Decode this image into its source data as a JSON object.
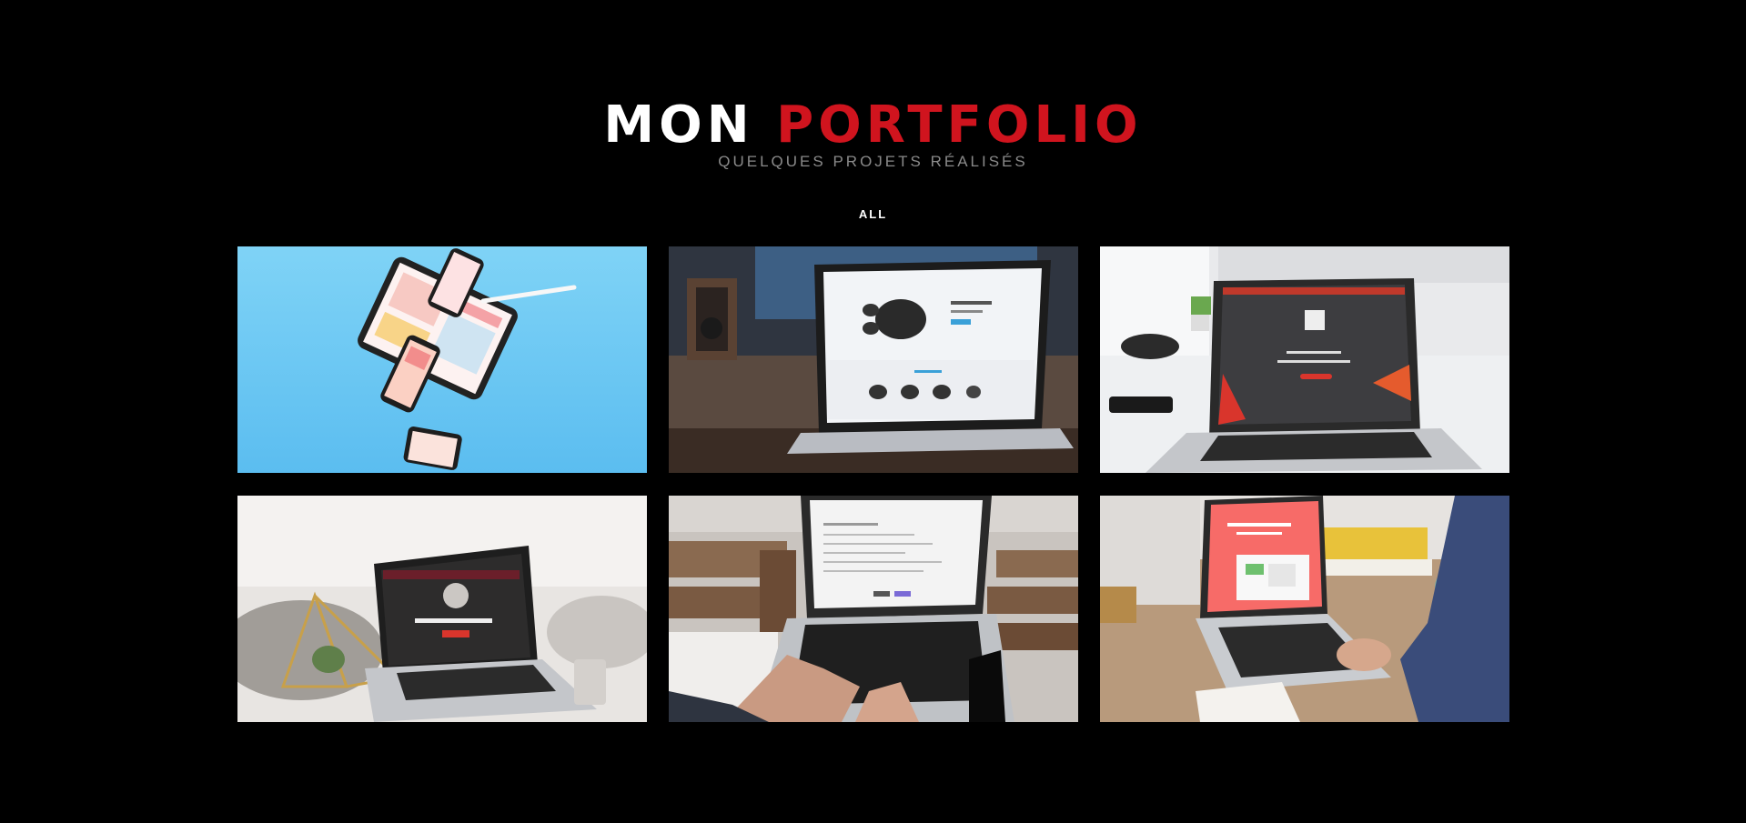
{
  "portfolio": {
    "title_white": "MON",
    "title_red": "PORTFOLIO",
    "subtitle": "QUELQUES PROJETS RÉALISÉS",
    "filters": [
      {
        "label": "ALL"
      }
    ],
    "colors": {
      "background": "#000000",
      "accent": "#d0141e",
      "subtitle": "#8a8a8a"
    },
    "projects": [
      {
        "preview": "tablet-and-phones-mockup-blue"
      },
      {
        "preview": "laptop-gaming-mouse-shop"
      },
      {
        "preview": "laptop-dark-landing-desk"
      },
      {
        "preview": "laptop-dark-site-bedroom"
      },
      {
        "preview": "laptop-hands-typing-code"
      },
      {
        "preview": "laptop-red-landing-office"
      }
    ]
  }
}
